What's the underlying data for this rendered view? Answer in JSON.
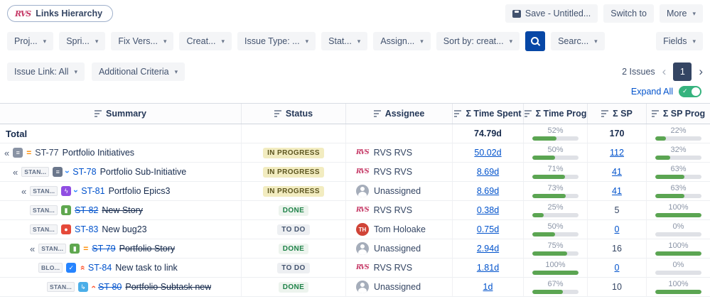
{
  "app": {
    "logo_text": "RVS",
    "title": "Links Hierarchy"
  },
  "topbar": {
    "save_label": "Save - Untitled...",
    "switch_label": "Switch to",
    "more_label": "More"
  },
  "filter_bar": {
    "filters": [
      {
        "id": "project",
        "label": "Proj..."
      },
      {
        "id": "sprint",
        "label": "Spri..."
      },
      {
        "id": "fix-version",
        "label": "Fix Vers..."
      },
      {
        "id": "created",
        "label": "Creat..."
      },
      {
        "id": "issue-type",
        "label": "Issue Type: ..."
      },
      {
        "id": "status",
        "label": "Stat..."
      },
      {
        "id": "assignee",
        "label": "Assign..."
      },
      {
        "id": "sort-by",
        "label": "Sort by: creat..."
      }
    ],
    "search_label": "Searc...",
    "fields_label": "Fields"
  },
  "secondary_bar": {
    "issue_link_label": "Issue Link: All",
    "additional_criteria_label": "Additional Criteria",
    "issues_count": "2 Issues",
    "page": "1"
  },
  "expand_all_label": "Expand All",
  "colors": {
    "link": "#0052CC",
    "progress_green": "#5BA552",
    "search_button": "#0747A6",
    "toggle_on": "#36B37E"
  },
  "table": {
    "columns": [
      {
        "id": "summary",
        "label": "Summary"
      },
      {
        "id": "status",
        "label": "Status"
      },
      {
        "id": "assignee",
        "label": "Assignee"
      },
      {
        "id": "time-spent",
        "label": "Σ Time Spent"
      },
      {
        "id": "time-prog",
        "label": "Σ Time Prog"
      },
      {
        "id": "sp",
        "label": "Σ SP"
      },
      {
        "id": "sp-prog",
        "label": "Σ SP Prog"
      }
    ],
    "rows": [
      {
        "total": true,
        "label": "Total",
        "time_spent": {
          "value": "74.79d",
          "link": false
        },
        "time_prog": 52,
        "sp": {
          "value": "170",
          "link": false
        },
        "sp_prog": 22
      },
      {
        "level": 0,
        "collapser": true,
        "issue_type": {
          "name": "initiative",
          "color": "#8993A4",
          "glyph": "≡"
        },
        "priority": {
          "name": "medium",
          "glyph": "=",
          "color": "#FF8B00",
          "rotate": 0
        },
        "key": "ST-77",
        "key_link": false,
        "summary": "Portfolio Initiatives",
        "status": {
          "label": "IN PROGRESS",
          "kind": "in-progress"
        },
        "assignee": {
          "type": "rvs",
          "name": "RVS RVS"
        },
        "time_spent": {
          "value": "50.02d",
          "link": true
        },
        "time_prog": 50,
        "sp": {
          "value": "112",
          "link": true
        },
        "sp_prog": 32
      },
      {
        "level": 1,
        "collapser": true,
        "link_badge": "STAN...",
        "issue_type": {
          "name": "sub-initiative",
          "color": "#6B778C",
          "glyph": "≡"
        },
        "priority": {
          "name": "low",
          "glyph": "›",
          "color": "#2684FF",
          "rotate": 90
        },
        "key": "ST-78",
        "key_link": true,
        "summary": "Portfolio Sub-Initiative",
        "status": {
          "label": "IN PROGRESS",
          "kind": "in-progress"
        },
        "assignee": {
          "type": "rvs",
          "name": "RVS RVS"
        },
        "time_spent": {
          "value": "8.69d",
          "link": true
        },
        "time_prog": 71,
        "sp": {
          "value": "41",
          "link": true
        },
        "sp_prog": 63
      },
      {
        "level": 2,
        "collapser": true,
        "link_badge": "STAN...",
        "issue_type": {
          "name": "epic",
          "color": "#904EE2",
          "glyph": "ϟ"
        },
        "priority": {
          "name": "low",
          "glyph": "›",
          "color": "#2684FF",
          "rotate": 90
        },
        "key": "ST-81",
        "key_link": true,
        "summary": "Portfolio Epics3",
        "status": {
          "label": "IN PROGRESS",
          "kind": "in-progress"
        },
        "assignee": {
          "type": "unassigned",
          "name": "Unassigned"
        },
        "time_spent": {
          "value": "8.69d",
          "link": true
        },
        "time_prog": 73,
        "sp": {
          "value": "41",
          "link": true
        },
        "sp_prog": 63
      },
      {
        "level": 3,
        "link_badge": "STAN...",
        "issue_type": {
          "name": "story",
          "color": "#5FA74F",
          "glyph": "▮"
        },
        "key": "ST-82",
        "key_link": true,
        "key_struck": true,
        "summary": "New Story",
        "summary_struck": true,
        "status": {
          "label": "DONE",
          "kind": "done"
        },
        "assignee": {
          "type": "rvs",
          "name": "RVS RVS"
        },
        "time_spent": {
          "value": "0.38d",
          "link": true
        },
        "time_prog": 25,
        "sp": {
          "value": "5",
          "link": false
        },
        "sp_prog": 100
      },
      {
        "level": 3,
        "link_badge": "STAN...",
        "issue_type": {
          "name": "bug",
          "color": "#E5493A",
          "glyph": "●"
        },
        "key": "ST-83",
        "key_link": true,
        "summary": "New bug23",
        "status": {
          "label": "TO DO",
          "kind": "todo"
        },
        "assignee": {
          "type": "initials",
          "name": "Tom Holoake",
          "initials": "TH",
          "color": "#D04437"
        },
        "time_spent": {
          "value": "0.75d",
          "link": true
        },
        "time_prog": 50,
        "sp": {
          "value": "0",
          "link": true
        },
        "sp_prog": 0
      },
      {
        "level": 3,
        "collapser": true,
        "link_badge": "STAN...",
        "issue_type": {
          "name": "story",
          "color": "#5FA74F",
          "glyph": "▮"
        },
        "priority": {
          "name": "medium",
          "glyph": "=",
          "color": "#FF8B00",
          "rotate": 0
        },
        "key": "ST-79",
        "key_link": true,
        "key_struck": true,
        "summary": "Portfolio Story",
        "summary_struck": true,
        "status": {
          "label": "DONE",
          "kind": "done"
        },
        "assignee": {
          "type": "unassigned",
          "name": "Unassigned"
        },
        "time_spent": {
          "value": "2.94d",
          "link": true
        },
        "time_prog": 75,
        "sp": {
          "value": "16",
          "link": false
        },
        "sp_prog": 100
      },
      {
        "level": 4,
        "link_badge": "BLO...",
        "issue_type": {
          "name": "task",
          "color": "#2684FF",
          "glyph": "✓"
        },
        "priority": {
          "name": "highest",
          "glyph": "»",
          "color": "#FF5630",
          "rotate": -90
        },
        "key": "ST-84",
        "key_link": true,
        "summary": "New task to link",
        "status": {
          "label": "TO DO",
          "kind": "todo"
        },
        "assignee": {
          "type": "rvs",
          "name": "RVS RVS"
        },
        "time_spent": {
          "value": "1.81d",
          "link": true
        },
        "time_prog": 100,
        "sp": {
          "value": "0",
          "link": true
        },
        "sp_prog": 0
      },
      {
        "level": 5,
        "link_badge": "STAN...",
        "issue_type": {
          "name": "subtask",
          "color": "#4BAEE8",
          "glyph": "↳"
        },
        "priority": {
          "name": "high",
          "glyph": "›",
          "color": "#FF5630",
          "rotate": -90
        },
        "key": "ST-80",
        "key_link": true,
        "key_struck": true,
        "summary": "Portfolio Subtask new",
        "summary_struck": true,
        "status": {
          "label": "DONE",
          "kind": "done"
        },
        "assignee": {
          "type": "unassigned",
          "name": "Unassigned"
        },
        "time_spent": {
          "value": "1d",
          "link": true
        },
        "time_prog": 67,
        "sp": {
          "value": "10",
          "link": false
        },
        "sp_prog": 100
      }
    ]
  }
}
